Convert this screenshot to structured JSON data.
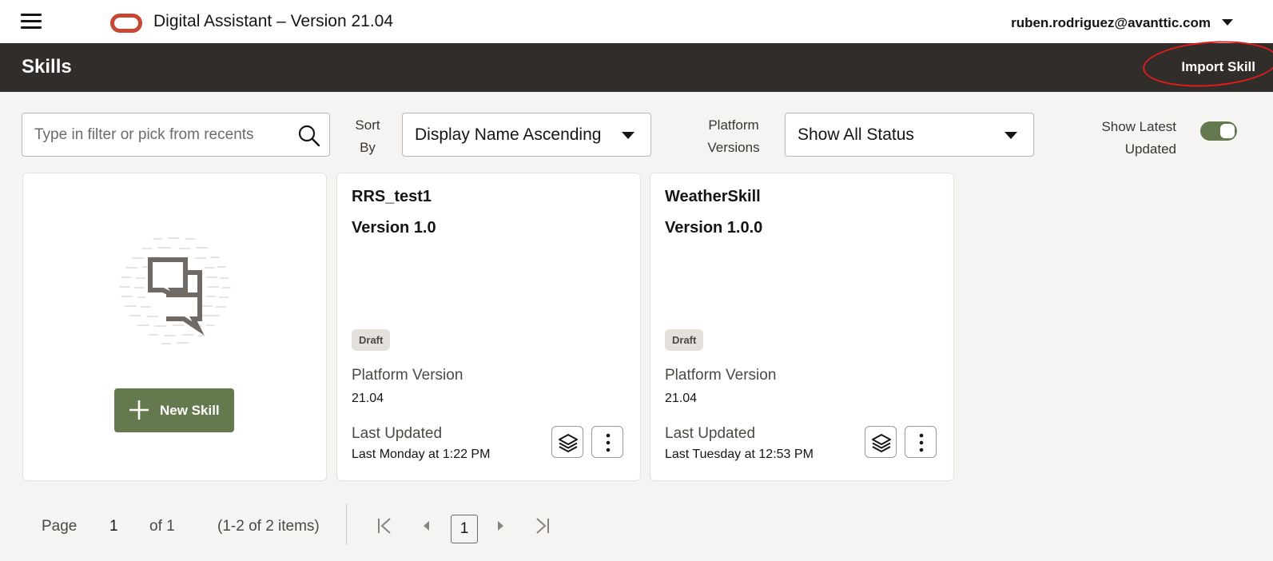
{
  "header": {
    "app_title": "Digital Assistant – Version 21.04",
    "user_email": "ruben.rodriguez@avanttic.com"
  },
  "titlebar": {
    "page_title": "Skills",
    "import_label": "Import Skill"
  },
  "filters": {
    "search_placeholder": "Type in filter or pick from recents",
    "sort_label_line1": "Sort",
    "sort_label_line2": "By",
    "sort_value": "Display Name Ascending",
    "platform_label_line1": "Platform",
    "platform_label_line2": "Versions",
    "platform_value": "Show All Status",
    "latest_label_line1": "Show Latest",
    "latest_label_line2": "Updated",
    "latest_toggle_on": true
  },
  "new_skill": {
    "button_label": "New Skill"
  },
  "skills": [
    {
      "name": "RRS_test1",
      "version": "Version 1.0",
      "status": "Draft",
      "platform_label": "Platform Version",
      "platform_value": "21.04",
      "updated_label": "Last Updated",
      "updated_value": "Last Monday at 1:22 PM"
    },
    {
      "name": "WeatherSkill",
      "version": "Version 1.0.0",
      "status": "Draft",
      "platform_label": "Platform Version",
      "platform_value": "21.04",
      "updated_label": "Last Updated",
      "updated_value": "Last Tuesday at 12:53 PM"
    }
  ],
  "pagination": {
    "page_label": "Page",
    "page_number": "1",
    "of_label": "of 1",
    "items_summary": "(1-2 of 2 items)",
    "current_page": "1"
  },
  "colors": {
    "accent_green": "#647a4e",
    "title_bar": "#312d2a",
    "oracle_red": "#c74634",
    "annotation_red": "#e21b1b"
  }
}
